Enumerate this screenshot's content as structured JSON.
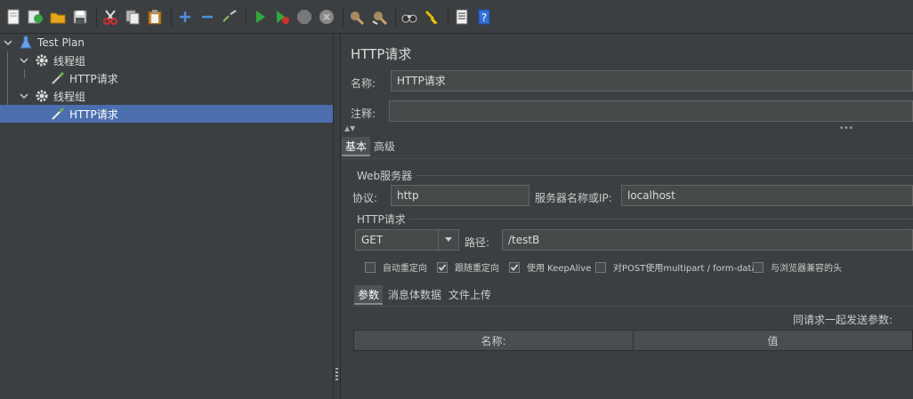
{
  "toolbar": {
    "buttons": [
      "new",
      "templates",
      "open",
      "save",
      "cut",
      "copy",
      "paste",
      "expand",
      "collapse",
      "toggle",
      "start",
      "start-no-pause",
      "stop",
      "shutdown",
      "clear",
      "clear-all",
      "search",
      "reset-search",
      "function-helper",
      "help"
    ]
  },
  "tree": {
    "items": [
      {
        "label": "Test Plan",
        "icon": "flask-icon",
        "level": 0
      },
      {
        "label": "线程组",
        "icon": "gear-icon",
        "level": 1
      },
      {
        "label": "HTTP请求",
        "icon": "pipette-icon",
        "level": 2
      },
      {
        "label": "线程组",
        "icon": "gear-icon",
        "level": 1
      },
      {
        "label": "HTTP请求",
        "icon": "pipette-icon",
        "level": 2,
        "selected": true
      }
    ]
  },
  "panel": {
    "title": "HTTP请求",
    "name_label": "名称:",
    "name_value": "HTTP请求",
    "comment_label": "注释:",
    "comment_value": "",
    "tabs": [
      "基本",
      "高级"
    ],
    "web_server": {
      "group_title": "Web服务器",
      "protocol_label": "协议:",
      "protocol_value": "http",
      "server_label": "服务器名称或IP:",
      "server_value": "localhost"
    },
    "http_request": {
      "group_title": "HTTP请求",
      "method": "GET",
      "path_label": "路径:",
      "path_value": "/testB"
    },
    "checkboxes": [
      {
        "label": "自动重定向",
        "checked": false
      },
      {
        "label": "跟随重定向",
        "checked": true
      },
      {
        "label": "使用 KeepAlive",
        "checked": true
      },
      {
        "label": "对POST使用multipart / form-data",
        "checked": false
      },
      {
        "label": "与浏览器兼容的头",
        "checked": false
      }
    ],
    "sub_tabs": [
      "参数",
      "消息体数据",
      "文件上传"
    ],
    "send_params_label": "同请求一起发送参数:",
    "table_headers": [
      "名称:",
      "值"
    ]
  },
  "colors": {
    "background": "#3c3f41",
    "selection": "#4b6eaf",
    "field": "#45494a"
  }
}
